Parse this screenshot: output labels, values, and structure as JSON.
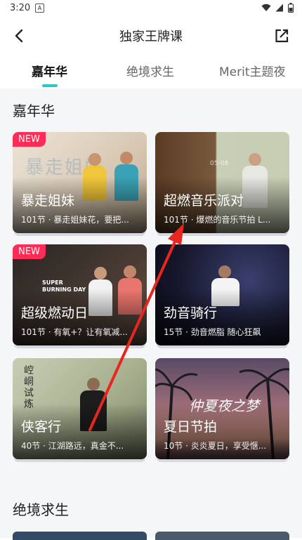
{
  "status_bar": {
    "time": "3:20",
    "notif_icon": "A"
  },
  "header": {
    "title": "独家王牌课"
  },
  "tabs": [
    {
      "label": "嘉年华",
      "active": true
    },
    {
      "label": "绝境求生",
      "active": false
    },
    {
      "label": "Merit主题夜",
      "active": false
    }
  ],
  "sections": [
    {
      "title": "嘉年华",
      "cards": [
        {
          "title": "暴走姐妹",
          "subtitle": "101节 · 暴走姐妹花，要把...",
          "badge": "NEW",
          "decor_text": "暴走姐妹"
        },
        {
          "title": "超燃音乐派对",
          "subtitle": "101节 · 爆燃的音乐节拍 L...",
          "badge": "",
          "decor_text": "05-08"
        },
        {
          "title": "超级燃动日",
          "subtitle": "101节 · 有氧+？让有氧减...",
          "badge": "NEW",
          "decor_text": "SUPER\nBURNING DAY"
        },
        {
          "title": "劲音骑行",
          "subtitle": "15节 · 劲音燃脂 随心狂飙",
          "badge": "",
          "decor_text": ""
        },
        {
          "title": "侠客行",
          "subtitle": "40节 · 江湖路远，真金不...",
          "badge": "",
          "decor_text": "崆峒试炼"
        },
        {
          "title": "夏日节拍",
          "subtitle": "10节 · 炎炎夏日，享受惬...",
          "badge": "",
          "decor_text": "仲夏夜之梦"
        }
      ]
    },
    {
      "title": "绝境求生"
    }
  ],
  "colors": {
    "accent": "#2ec8c4",
    "badge": "#ff2d55",
    "arrow": "#e8261f"
  }
}
